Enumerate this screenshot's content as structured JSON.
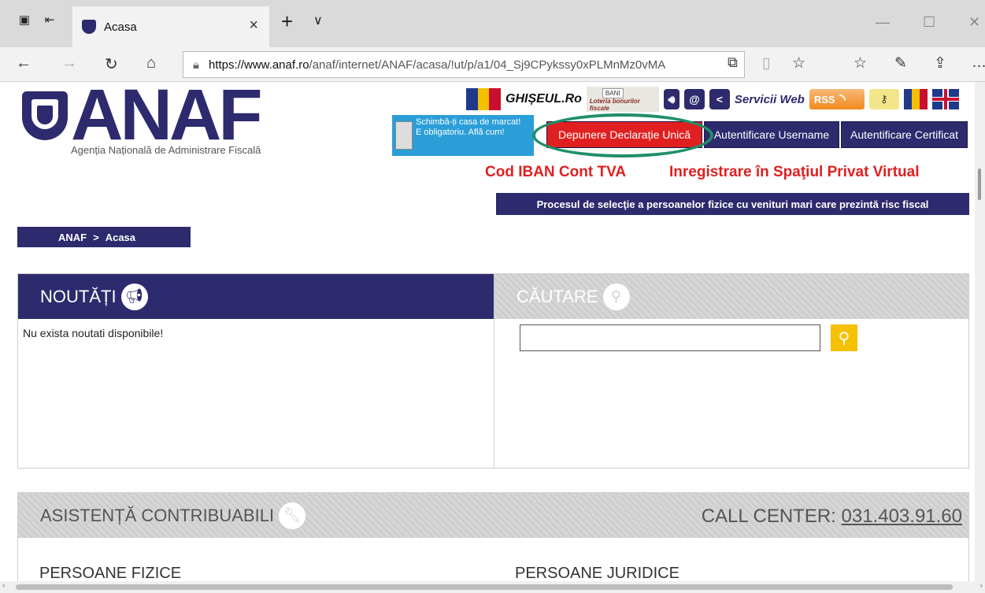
{
  "browser": {
    "tab_title": "Acasa",
    "url_domain": "https://www.anaf.ro",
    "url_rest": "/anaf/internet/ANAF/acasa/!ut/p/a1/04_Sj9CPykssy0xPLMnMz0vMA"
  },
  "logo": {
    "text": "ANAF",
    "subtitle": "Agenția Națională de Administrare Fiscală"
  },
  "top_icons": {
    "ghiseul": "GHIȘEUL.Ro",
    "loteria": "Loteria bonurilor fiscale",
    "bani": "BANI",
    "servicii": "Servicii Web",
    "rss": "RSS"
  },
  "promo": {
    "line1": "Schimbă-ți casa de marcat!",
    "line2": "E obligatoriu. Află cum!"
  },
  "buttons": {
    "declaratie": "Depunere Declarație Unică",
    "auth_user": "Autentificare Username",
    "auth_cert": "Autentificare Certificat"
  },
  "links": {
    "iban": "Cod IBAN Cont TVA",
    "spv": "Inregistrare în Spaţiul Privat Virtual",
    "proces": "Procesul de selecţie a persoanelor fizice cu venituri mari care prezintă risc fiscal"
  },
  "breadcrumb": {
    "root": "ANAF",
    "sep": ">",
    "current": "Acasa"
  },
  "news": {
    "title": "NOUTĂȚI",
    "empty": "Nu exista noutati disponibile!"
  },
  "search": {
    "title": "CĂUTARE",
    "value": ""
  },
  "asistenta": {
    "title": "ASISTENȚĂ CONTRIBUABILI",
    "call_label": "CALL CENTER:",
    "call_number": "031.403.91.60",
    "persoane_fizice": "PERSOANE FIZICE",
    "persoane_juridice": "PERSOANE JURIDICE"
  },
  "colors": {
    "brand": "#2d2a6e",
    "accent_red": "#e02020",
    "highlight": "#1f8f6a",
    "search_button": "#f5c000"
  }
}
